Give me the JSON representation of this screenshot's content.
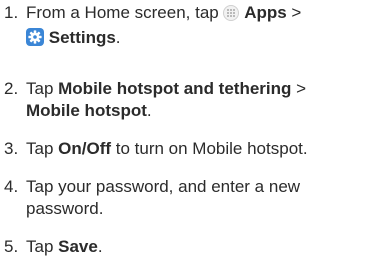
{
  "steps": [
    {
      "number": "1.",
      "parts": [
        "From a Home screen, tap ",
        "Apps",
        " > ",
        "Settings",
        "."
      ],
      "icons": [
        "apps-grid-icon",
        "settings-gear-icon"
      ]
    },
    {
      "number": "2.",
      "parts": [
        "Tap ",
        "Mobile hotspot and tethering",
        " > ",
        "Mobile hotspot",
        "."
      ]
    },
    {
      "number": "3.",
      "parts": [
        "Tap ",
        "On/Off",
        " to turn on Mobile hotspot."
      ]
    },
    {
      "number": "4.",
      "parts": [
        "Tap your password, and enter a new",
        "password."
      ]
    },
    {
      "number": "5.",
      "parts": [
        "Tap ",
        "Save",
        "."
      ]
    }
  ],
  "colors": {
    "text": "#2b2b2b",
    "settings_icon_bg": "#3b86d6",
    "apps_icon": "#a9a9a9"
  }
}
